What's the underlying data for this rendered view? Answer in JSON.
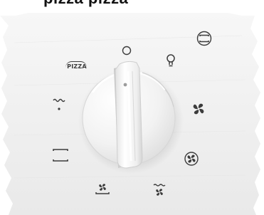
{
  "top_partial_text": "pizza pizza",
  "dial": {
    "name": "oven mode selector knob"
  },
  "labels": {
    "pizza": "PIZZA"
  },
  "icons": [
    "off-circle-icon",
    "lamp-icon",
    "top-bottom-heat-icon",
    "fan-icon",
    "fan-ring-icon",
    "fan-grill-icon",
    "fan-bottom-heat-icon",
    "bottom-top-heat-icon",
    "grill-small-icon",
    "pizza-icon"
  ],
  "colors": {
    "panel_top": "#f7f7f7",
    "panel_bottom": "#ececec",
    "icon": "#3c3c3c",
    "knob": "#f4f4f4"
  }
}
